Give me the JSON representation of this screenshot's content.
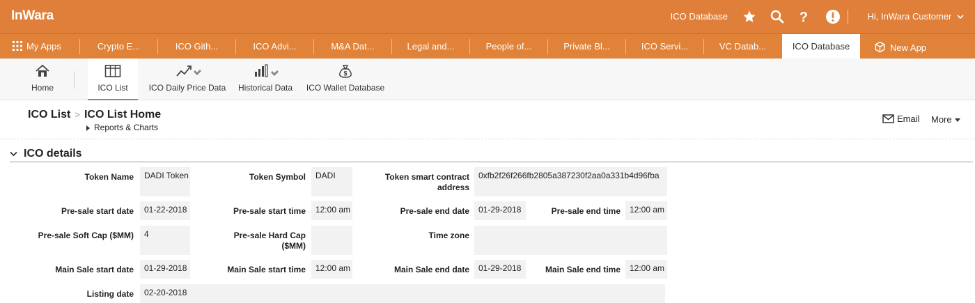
{
  "app": {
    "logo": "InWara",
    "top_link": "ICO Database",
    "greeting": "Hi, InWara Customer",
    "icons": [
      "star-icon",
      "search-icon",
      "help-icon",
      "alert-icon",
      "chevron-down-icon"
    ]
  },
  "tabs": {
    "my_apps": "My Apps",
    "items": [
      "Crypto E...",
      "ICO Gith...",
      "ICO Advi...",
      "M&A Dat...",
      "Legal and...",
      "People of...",
      "Private Bl...",
      "ICO Servi...",
      "VC Datab..."
    ],
    "active": "ICO Database",
    "new_app": "New App"
  },
  "subnav": {
    "home": "Home",
    "ico_list": "ICO List",
    "daily_price": "ICO Daily Price Data",
    "historical": "Historical Data",
    "wallet": "ICO Wallet Database"
  },
  "header": {
    "crumb_root": "ICO List",
    "crumb_sep": ">",
    "title": "ICO List Home",
    "reports": "Reports & Charts",
    "email": "Email",
    "more": "More"
  },
  "section": {
    "title": "ICO details",
    "fields": {
      "token_name": {
        "label": "Token Name",
        "value": "DADI Token"
      },
      "token_symbol": {
        "label": "Token Symbol",
        "value": "DADI"
      },
      "token_contract": {
        "label": "Token smart contract address",
        "value": "0xfb2f26f266fb2805a387230f2aa0a331b4d96fba"
      },
      "presale_start_date": {
        "label": "Pre-sale start date",
        "value": "01-22-2018"
      },
      "presale_start_time": {
        "label": "Pre-sale start time",
        "value": "12:00 am"
      },
      "presale_end_date": {
        "label": "Pre-sale end date",
        "value": "01-29-2018"
      },
      "presale_end_time": {
        "label": "Pre-sale end time",
        "value": "12:00 am"
      },
      "presale_soft_cap": {
        "label": "Pre-sale Soft Cap ($MM)",
        "value": "4"
      },
      "presale_hard_cap": {
        "label": "Pre-sale Hard Cap ($MM)",
        "value": ""
      },
      "time_zone": {
        "label": "Time zone",
        "value": ""
      },
      "main_start_date": {
        "label": "Main Sale start date",
        "value": "01-29-2018"
      },
      "main_start_time": {
        "label": "Main Sale start time",
        "value": "12:00 am"
      },
      "main_end_date": {
        "label": "Main Sale end date",
        "value": "01-29-2018"
      },
      "main_end_time": {
        "label": "Main Sale end time",
        "value": "12:00 am"
      },
      "listing_date": {
        "label": "Listing date",
        "value": "02-20-2018"
      }
    }
  }
}
